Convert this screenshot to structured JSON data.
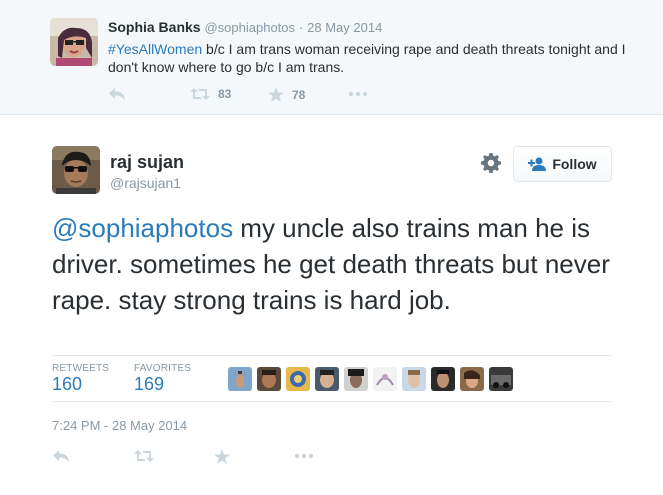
{
  "parent_tweet": {
    "name": "Sophia Banks",
    "handle": "@sophiaphotos",
    "separator": "·",
    "date": "28 May 2014",
    "hashtag": "#YesAllWomen",
    "text": " b/c I am trans woman receiving rape and death threats tonight and I don't know where to go b/c I am trans.",
    "retweet_count": "83",
    "favorite_count": "78"
  },
  "main_tweet": {
    "name": "raj sujan",
    "handle": "@rajsujan1",
    "follow_label": "Follow",
    "mention": "@sophiaphotos",
    "text": " my uncle also trains man he is driver. sometimes he get death threats but never rape. stay strong trains is hard job.",
    "retweets_label": "RETWEETS",
    "retweets_count": "160",
    "favorites_label": "FAVORITES",
    "favorites_count": "169",
    "timestamp": "7:24 PM - 28 May 2014"
  },
  "colors": {
    "link_blue": "#2b7bb9",
    "muted_gray": "#8899a6",
    "icon_gray": "#ccd6dd",
    "parent_bg": "#f5f8fa",
    "border": "#e1e8ed"
  }
}
